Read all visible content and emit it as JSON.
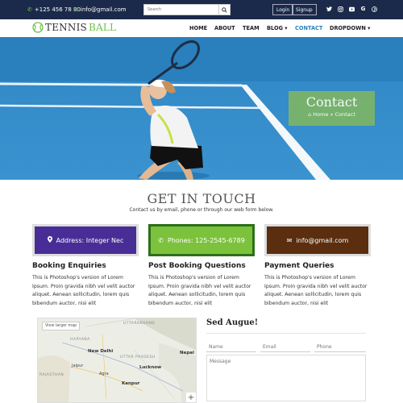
{
  "topbar": {
    "phone": "+125 456 78 90",
    "email": "info@gmail.com",
    "search_placeholder": "Search",
    "login_label": "Login",
    "signup_label": "Signup",
    "social_icons": [
      "twitter-icon",
      "instagram-icon",
      "youtube-icon",
      "google-icon",
      "pinterest-icon"
    ]
  },
  "brand": {
    "word1": "TENNIS",
    "word2": " BALL"
  },
  "nav": {
    "items": [
      "HOME",
      "ABOUT",
      "TEAM",
      "BLOG ▾",
      "CONTACT",
      "DROPDOWN ▾"
    ],
    "active": "CONTACT"
  },
  "hero": {
    "title": "Contact",
    "breadcrumb_home": "Home",
    "breadcrumb_sep": "»",
    "breadcrumb_current": "Contact"
  },
  "section": {
    "title": "GET IN TOUCH",
    "subtitle": "Contact us by email, phone or through our web form below."
  },
  "info_boxes": [
    {
      "icon": "map-marker-icon",
      "label": "Address: Integer Nec"
    },
    {
      "icon": "phone-icon",
      "label": "Phones: 125-2545-6789"
    },
    {
      "icon": "envelope-icon",
      "label": "info@gmail.com"
    }
  ],
  "columns": [
    {
      "title": "Booking Enquiries",
      "text": "This is Photoshop's version of Lorem Ipsum. Proin gravida nibh vel velit auctor aliquet. Aenean sollicitudin, lorem quis bibendum auctor, nisi elit"
    },
    {
      "title": "Post Booking Questions",
      "text": "This is Photoshop's version of Lorem Ipsum. Proin gravida nibh vel velit auctor aliquet. Aenean sollicitudin, lorem quis bibendum auctor, nisi elit"
    },
    {
      "title": "Payment Queries",
      "text": "This is Photoshop's version of Lorem Ipsum. Proin gravida nibh vel velit auctor aliquet. Aenean sollicitudin, lorem quis bibendum auctor, nisi elit"
    }
  ],
  "map": {
    "view_larger": "View larger map",
    "labels": [
      "UTTARAKHAND",
      "HARYANA",
      "New Delhi",
      "Jaipur",
      "RAJASTHAN",
      "UTTAR PRADESH",
      "Lucknow",
      "Kanpur",
      "Nepal",
      "Agra"
    ],
    "zoom_in": "+"
  },
  "form": {
    "title": "Sed Augue!",
    "name_placeholder": "Name",
    "email_placeholder": "Email",
    "phone_placeholder": "Phone",
    "message_placeholder": "Message"
  },
  "colors": {
    "topbar": "#1b2a4a",
    "accent_green": "#6fc24a",
    "nav_active": "#2a7fc1",
    "box_purple": "#482d96",
    "box_green": "#7cc23c",
    "box_brown": "#5a2e0e",
    "hero_contact_box": "#7bb36a"
  }
}
